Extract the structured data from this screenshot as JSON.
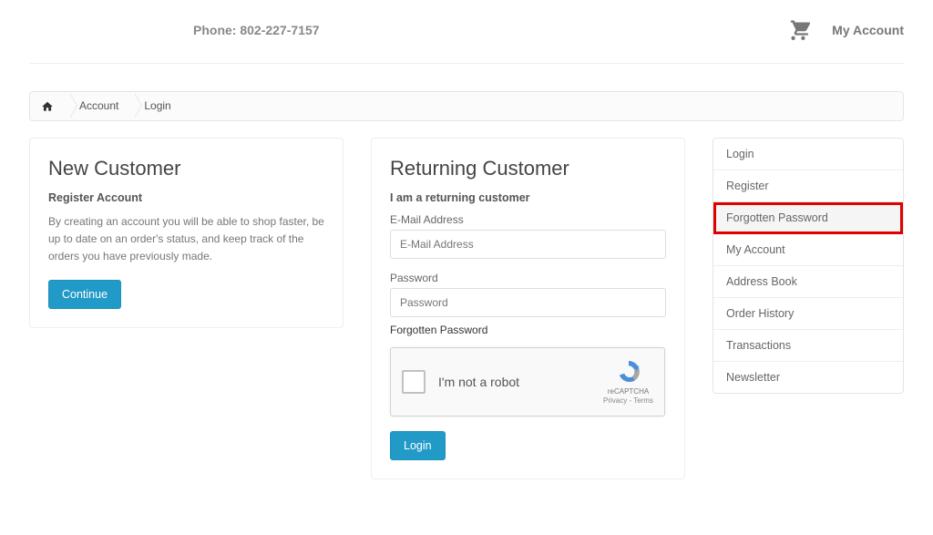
{
  "top": {
    "phone": "Phone: 802-227-7157",
    "my_account": "My Account"
  },
  "breadcrumb": {
    "account": "Account",
    "login": "Login"
  },
  "new_customer": {
    "heading": "New Customer",
    "subheading": "Register Account",
    "description": "By creating an account you will be able to shop faster, be up to date on an order's status, and keep track of the orders you have previously made.",
    "continue_btn": "Continue"
  },
  "returning": {
    "heading": "Returning Customer",
    "subheading": "I am a returning customer",
    "email_label": "E-Mail Address",
    "email_placeholder": "E-Mail Address",
    "password_label": "Password",
    "password_placeholder": "Password",
    "forgot_link": "Forgotten Password",
    "captcha_label": "I'm not a robot",
    "captcha_brand": "reCAPTCHA",
    "captcha_legal": "Privacy - Terms",
    "login_btn": "Login"
  },
  "sidebar": {
    "items": [
      {
        "label": "Login"
      },
      {
        "label": "Register"
      },
      {
        "label": "Forgotten Password"
      },
      {
        "label": "My Account"
      },
      {
        "label": "Address Book"
      },
      {
        "label": "Order History"
      },
      {
        "label": "Transactions"
      },
      {
        "label": "Newsletter"
      }
    ],
    "highlight_index": 2
  }
}
